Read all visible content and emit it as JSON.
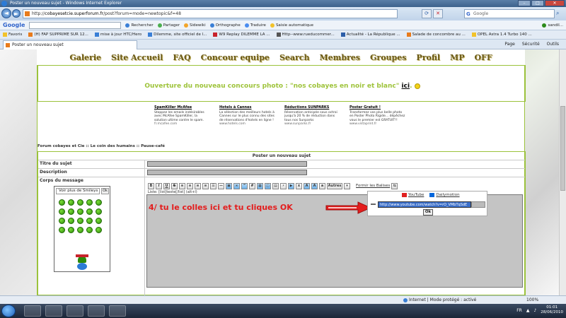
{
  "window": {
    "title": "Poster un nouveau sujet - Windows Internet Explorer"
  },
  "address": {
    "prefix": "http://",
    "domain": "cobayesetcie.superforum.fr",
    "path": "/post?forum=mode=newtopic&f=48",
    "search_placeholder": "Google"
  },
  "google_bar": {
    "logo": "Google",
    "items": [
      "Rechercher",
      "Partager",
      "Sidewiki",
      "Orthographe",
      "Traduire",
      "Saisie automatique",
      "sandil..."
    ]
  },
  "favorites": {
    "label": "Favoris",
    "items": [
      "(H) FAP SUPPRIME SUR 12...",
      "mise à jour HTC/Hero",
      "Dilemme, site officiel de l...",
      "W9 Replay DILEMME LA ...",
      "Http--www.rueducommer...",
      "Actualité - La République ...",
      "Salade de concombre au ...",
      "OPEL Astra 1.4 Turbo 140 ..."
    ]
  },
  "tab": {
    "title": "Poster un nouveau sujet"
  },
  "commands": [
    "Page",
    "Sécurité",
    "Outils"
  ],
  "site_nav": [
    "Galerie",
    "Site Accueil",
    "FAQ",
    "Concour equipe",
    "Search",
    "Membres",
    "Groupes",
    "Profil",
    "MP",
    "OFF"
  ],
  "announcement": {
    "text": "Ouverture du nouveau concours photo : \"nos cobayes en noir et blanc\"",
    "link": "ici",
    "suffix": "."
  },
  "ads": [
    {
      "title": "SpamKiller McAfee",
      "body": "Stoppez les emails indésirables avec McAfee SpamKiller, la solution ultime contre le spam.",
      "url": "fr.mcafee.com"
    },
    {
      "title": "Hotels à Cannes",
      "body": "La sélection des meilleurs hotels à Cannes sur le plus connu des sites de réservations d'hotels en ligne !",
      "url": "www.hotels.com"
    },
    {
      "title": "Réductions SUNPARKS",
      "body": "Réservation anticipée sous octroi jusqu'à 20 % de réduction dans tous nos Sunparks",
      "url": "www.sunparks.fr"
    },
    {
      "title": "Poster Gratuit !",
      "body": "Transformez vos plus belle photo en Poster Photo Rigide... dépêchez vous le premier est GRATUIT!!",
      "url": "www.vistaprint.fr"
    }
  ],
  "breadcrumb": "Forum cobayes et Cie  ::  Le coin des humains :: Pause-café",
  "form": {
    "header": "Poster un nouveau sujet",
    "subject_label": "Titre du sujet",
    "description_label": "Description",
    "body_label": "Corps du message",
    "smiley_select": "Voir plus de Smileys",
    "smiley_ok": "Ok",
    "autres_label": "Autres",
    "format_label": "Formir les Balises",
    "hint": "Liste: [list]texte[/list]  (alt+l)"
  },
  "toolbar_buttons": [
    "B",
    "I",
    "U",
    "S"
  ],
  "annotation": "4/ tu le colles ici et tu cliques OK",
  "video_dropdown": {
    "youtube": "YouTube",
    "dailymotion": "Dailymotion",
    "url": "http://www.youtube.com/watch?v=rO_VMbTqSdE",
    "ok": "Ok"
  },
  "status": {
    "zone": "Internet | Mode protégé : activé",
    "zoom": "100%"
  },
  "taskbar": {
    "lang": "FR",
    "time": "01:01",
    "date": "28/06/2010"
  },
  "colors": {
    "accent_green": "#9ec33a",
    "annotation_red": "#e31d1d"
  }
}
